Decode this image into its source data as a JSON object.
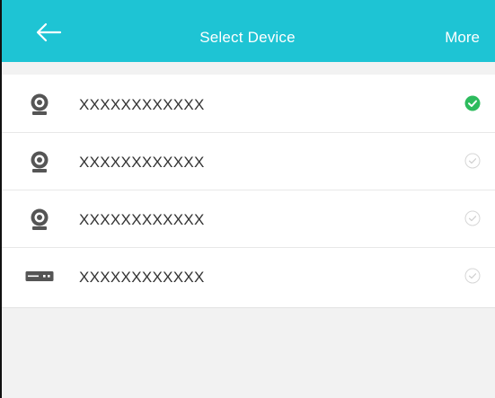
{
  "header": {
    "back_icon": "arrow-left-icon",
    "title": "Select Device",
    "more_label": "More",
    "background": "#1ec4d4"
  },
  "devices": [
    {
      "label": "XXXXXXXXXXXX",
      "type": "camera-icon",
      "selected": true
    },
    {
      "label": "XXXXXXXXXXXX",
      "type": "camera-icon",
      "selected": false
    },
    {
      "label": "XXXXXXXXXXXX",
      "type": "camera-icon",
      "selected": false
    },
    {
      "label": "XXXXXXXXXXXX",
      "type": "recorder-icon",
      "selected": false
    }
  ],
  "colors": {
    "accent": "#1ec4d4",
    "selected_check": "#2dbb5d",
    "unselected_check": "#cfcfcf"
  }
}
